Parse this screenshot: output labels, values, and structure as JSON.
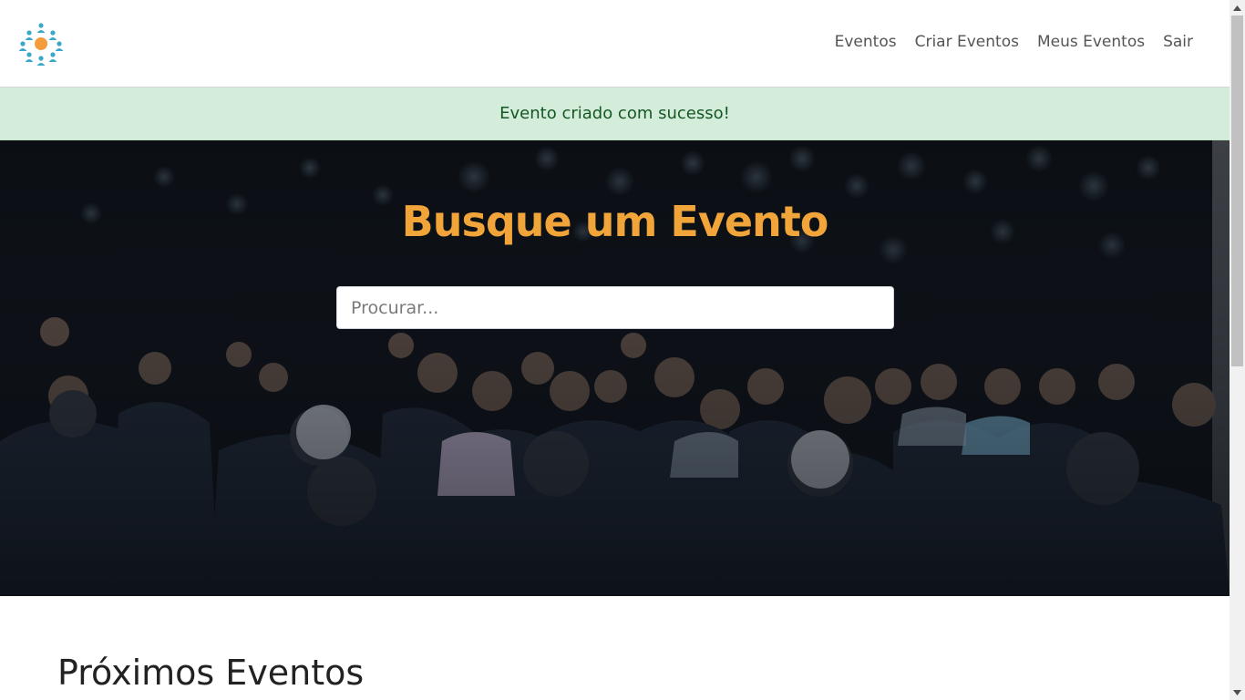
{
  "navbar": {
    "logo_name": "people-network-logo",
    "links": [
      {
        "label": "Eventos"
      },
      {
        "label": "Criar Eventos"
      },
      {
        "label": "Meus Eventos"
      },
      {
        "label": "Sair"
      }
    ]
  },
  "alert": {
    "message": "Evento criado com sucesso!",
    "color": "#d4edda"
  },
  "hero": {
    "title": "Busque um Evento",
    "title_color": "#f0a43a",
    "search_placeholder": "Procurar..."
  },
  "main": {
    "section_title": "Próximos Eventos"
  },
  "colors": {
    "logo_people": "#3aa8c8",
    "logo_center": "#f39c3c"
  }
}
